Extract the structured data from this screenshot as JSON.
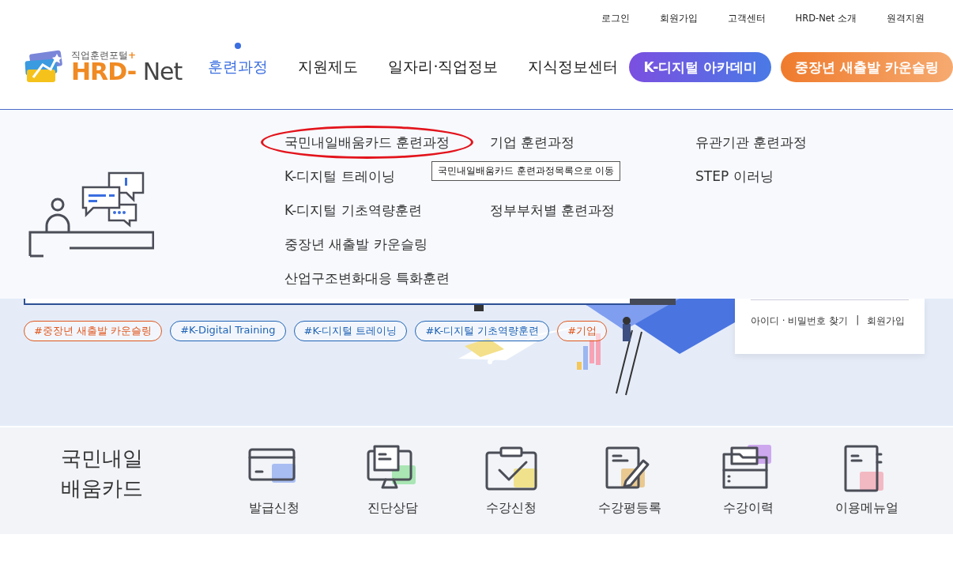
{
  "utility_links": [
    "로그인",
    "회원가입",
    "고객센터",
    "HRD-Net 소개",
    "원격지원"
  ],
  "logo": {
    "tagline": "직업훈련포털",
    "tagline_mark": "+",
    "wordmark_accent": "HRD-",
    "wordmark_rest": " Net"
  },
  "nav": [
    {
      "label": "훈련과정",
      "selected": true
    },
    {
      "label": "지원제도",
      "selected": false
    },
    {
      "label": "일자리·직업정보",
      "selected": false
    },
    {
      "label": "지식정보센터",
      "selected": false
    }
  ],
  "nav_buttons": [
    {
      "label": "K-디지털 아카데미",
      "kind": "purple"
    },
    {
      "label": "중장년 새출발 카운슬링",
      "kind": "orange"
    }
  ],
  "mega_menu": {
    "columns": [
      [
        {
          "label": "국민내일배움카드 훈련과정",
          "circled": true
        },
        {
          "label": "K-디지털 트레이닝",
          "circled": false
        },
        {
          "label": "K-디지털 기초역량훈련",
          "circled": false
        },
        {
          "label": "중장년 새출발 카운슬링",
          "circled": false
        },
        {
          "label": "산업구조변화대응 특화훈련",
          "circled": false
        }
      ],
      [
        {
          "label": "기업 훈련과정",
          "circled": false
        },
        {
          "label": "정부부처별 훈련과정",
          "circled": false
        }
      ],
      [
        {
          "label": "유관기관 훈련과정",
          "circled": false
        },
        {
          "label": "STEP 이러닝",
          "circled": false
        }
      ]
    ],
    "tooltip": "국민내일배움카드 훈련과정목록으로 이동"
  },
  "hero": {
    "tags": [
      {
        "label": "#중장년 새출발 카운슬링",
        "color": "#e0561c"
      },
      {
        "label": "#K-Digital Training",
        "color": "#1f63b5"
      },
      {
        "label": "#K-디지털 트레이닝",
        "color": "#1f63b5"
      },
      {
        "label": "#K-디지털 기초역량훈련",
        "color": "#1f63b5"
      },
      {
        "label": "#기업",
        "color": "#e0561c"
      }
    ],
    "login_links": [
      "아이디 · 비밀번호 찾기",
      "회원가입"
    ],
    "login_separator": "|"
  },
  "quick_menu": {
    "title": "국민내일 배움카드",
    "items": [
      {
        "label": "발급신청",
        "kind": "card",
        "color": "#a8bdf2"
      },
      {
        "label": "진단상담",
        "kind": "monitor",
        "color": "#a9e6b4"
      },
      {
        "label": "수강신청",
        "kind": "clipboard",
        "color": "#f0e28c"
      },
      {
        "label": "수강평등록",
        "kind": "note",
        "color": "#e9c990"
      },
      {
        "label": "수강이력",
        "kind": "folder",
        "color": "#cda8ee"
      },
      {
        "label": "이용메뉴얼",
        "kind": "book",
        "color": "#f3b9c2"
      }
    ]
  }
}
